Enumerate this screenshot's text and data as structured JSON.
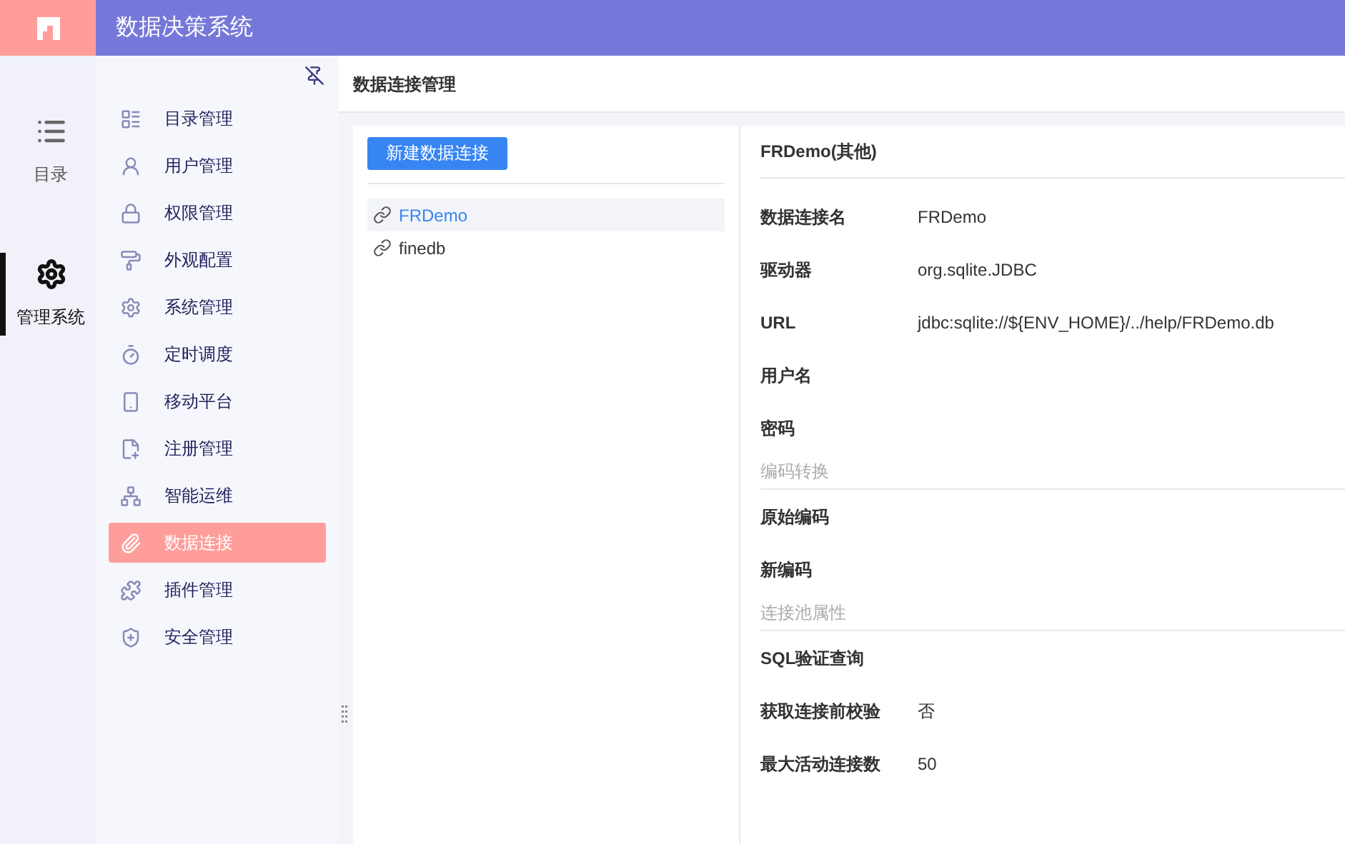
{
  "header": {
    "title": "数据决策系统"
  },
  "rail": [
    {
      "label": "目录",
      "selected": false
    },
    {
      "label": "管理系统",
      "selected": true
    }
  ],
  "menu": [
    {
      "label": "目录管理",
      "selected": false
    },
    {
      "label": "用户管理",
      "selected": false
    },
    {
      "label": "权限管理",
      "selected": false
    },
    {
      "label": "外观配置",
      "selected": false
    },
    {
      "label": "系统管理",
      "selected": false
    },
    {
      "label": "定时调度",
      "selected": false
    },
    {
      "label": "移动平台",
      "selected": false
    },
    {
      "label": "注册管理",
      "selected": false
    },
    {
      "label": "智能运维",
      "selected": false
    },
    {
      "label": "数据连接",
      "selected": true
    },
    {
      "label": "插件管理",
      "selected": false
    },
    {
      "label": "安全管理",
      "selected": false
    }
  ],
  "page_title": "数据连接管理",
  "new_button": "新建数据连接",
  "connections": [
    {
      "name": "FRDemo",
      "selected": true
    },
    {
      "name": "finedb",
      "selected": false
    }
  ],
  "detail": {
    "title": "FRDemo(其他)",
    "rows": [
      {
        "kind": "field",
        "label": "数据连接名",
        "value": "FRDemo"
      },
      {
        "kind": "field",
        "label": "驱动器",
        "value": "org.sqlite.JDBC"
      },
      {
        "kind": "field",
        "label": "URL",
        "value": "jdbc:sqlite://${ENV_HOME}/../help/FRDemo.db"
      },
      {
        "kind": "field",
        "label": "用户名"
      },
      {
        "kind": "field",
        "label": "密码"
      },
      {
        "kind": "section",
        "label": "编码转换"
      },
      {
        "kind": "field",
        "label": "原始编码"
      },
      {
        "kind": "field",
        "label": "新编码"
      },
      {
        "kind": "section",
        "label": "连接池属性"
      },
      {
        "kind": "field",
        "label": "SQL验证查询"
      },
      {
        "kind": "field",
        "label": "获取连接前校验",
        "value": "否"
      },
      {
        "kind": "field",
        "label": "最大活动连接数",
        "value": "50"
      }
    ]
  }
}
